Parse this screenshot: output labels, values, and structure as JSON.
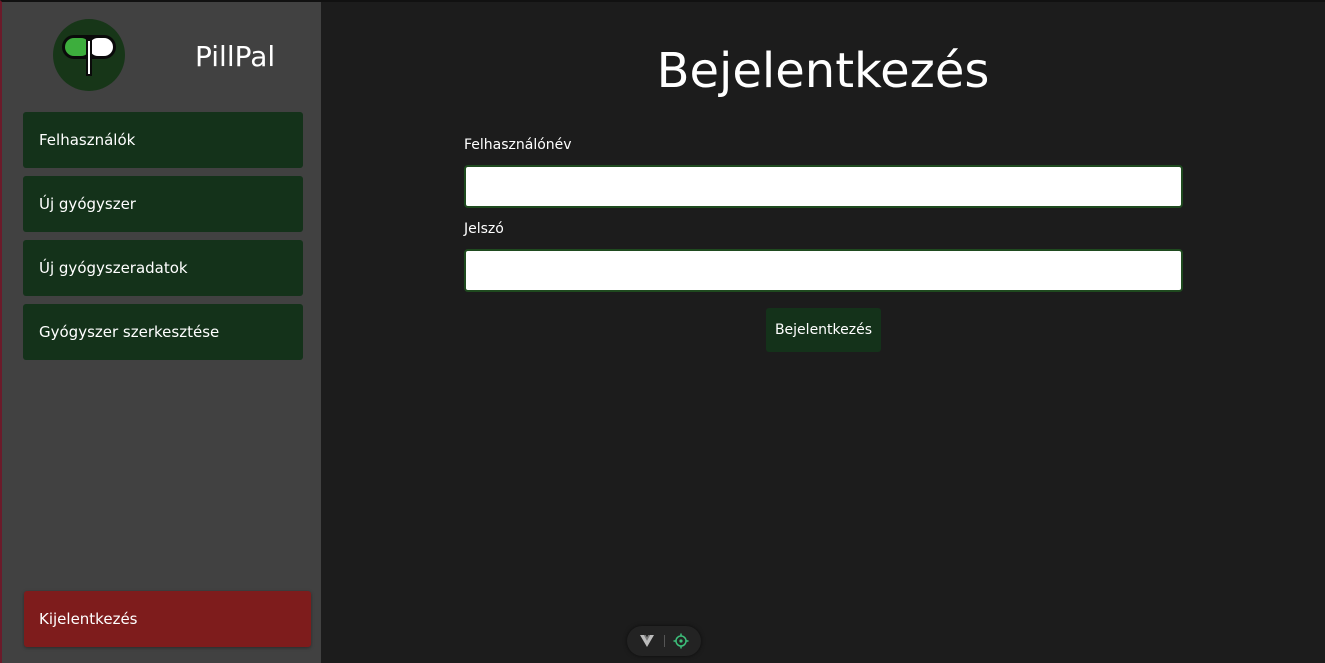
{
  "app": {
    "brand": "PillPal"
  },
  "sidebar": {
    "items": [
      {
        "label": "Felhasználók"
      },
      {
        "label": "Új gyógyszer"
      },
      {
        "label": "Új gyógyszeradatok"
      },
      {
        "label": "Gyógyszer szerkesztése"
      }
    ],
    "logout_label": "Kijelentkezés"
  },
  "login": {
    "title": "Bejelentkezés",
    "username_label": "Felhasználónév",
    "username_value": "",
    "password_label": "Jelszó",
    "password_value": "",
    "submit_label": "Bejelentkezés"
  },
  "devtools": {
    "icons": [
      "vue-logo-icon",
      "target-icon"
    ]
  },
  "colors": {
    "sidebar_bg": "#414141",
    "main_bg": "#1c1c1c",
    "nav_button": "#14321a",
    "logout_button": "#7e1c1c",
    "logo_green": "#3dae3d"
  }
}
